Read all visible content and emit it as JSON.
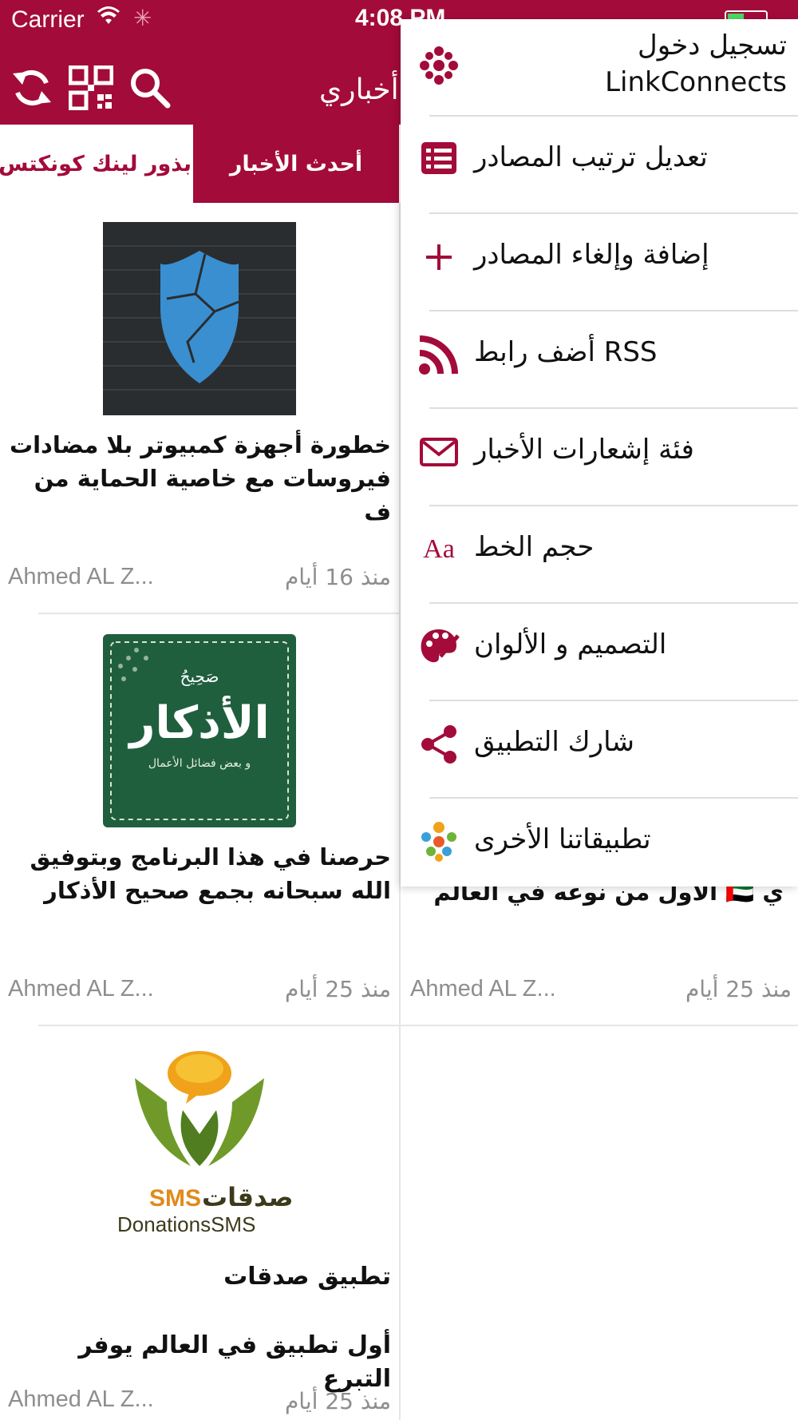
{
  "status_bar": {
    "carrier": "Carrier",
    "time": "4:08 PM"
  },
  "header": {
    "title": "أخباري"
  },
  "tabs": {
    "active": "أحدث الأخبار",
    "other": "بذور لينك كونكتس"
  },
  "colors": {
    "brand": "#a30b3a",
    "muted_text": "#8e8e8e",
    "divider": "#e6e6e6"
  },
  "cards": [
    {
      "title": "خطورة أجهزة كمبيوتر بلا مضادات فيروسات مع خاصية الحماية من ف",
      "author": "Ahmed AL Z...",
      "date": "منذ 16 أيام",
      "image_icon": "cracked-shield-icon"
    },
    {
      "title": "حرصنا في هذا البرنامج وبتوفيق الله سبحانه بجمع صحيح الأذكار",
      "author": "Ahmed AL Z...",
      "date": "منذ 25 أيام",
      "image_icon": "azkar-app-icon",
      "image_text": {
        "top": "صَحِيحُ",
        "main": "الأذكار",
        "sub": "و بعض فضائل الأعمال"
      }
    },
    {
      "title": "ي 🇦🇪 الأول من نوعه في العالم",
      "author": "Ahmed AL Z...",
      "date": "منذ 25 أيام"
    },
    {
      "title": "تطبيق صدقات",
      "subtitle": "أول تطبيق في العالم يوفر التبرع",
      "author": "Ahmed AL Z...",
      "date": "منذ 25 أيام",
      "image_icon": "donations-sms-logo",
      "image_text": {
        "ar": "صدقات",
        "sms": "SMS",
        "en": "DonationsSMS"
      }
    }
  ],
  "menu": {
    "items": [
      {
        "label": "تسجيل دخول LinkConnects",
        "icon": "linkconnects-logo-icon"
      },
      {
        "label": "تعديل ترتيب المصادر",
        "icon": "list-order-icon"
      },
      {
        "label": "إضافة وإلغاء المصادر",
        "icon": "plus-icon"
      },
      {
        "label": "أضف رابط RSS",
        "icon": "rss-icon"
      },
      {
        "label": "فئة إشعارات الأخبار",
        "icon": "envelope-icon"
      },
      {
        "label": "حجم الخط",
        "icon": "font-size-icon",
        "icon_text": "Aa"
      },
      {
        "label": "التصميم و الألوان",
        "icon": "palette-icon"
      },
      {
        "label": "شارك التطبيق",
        "icon": "share-icon"
      },
      {
        "label": "تطبيقاتنا الأخرى",
        "icon": "other-apps-icon"
      }
    ]
  }
}
